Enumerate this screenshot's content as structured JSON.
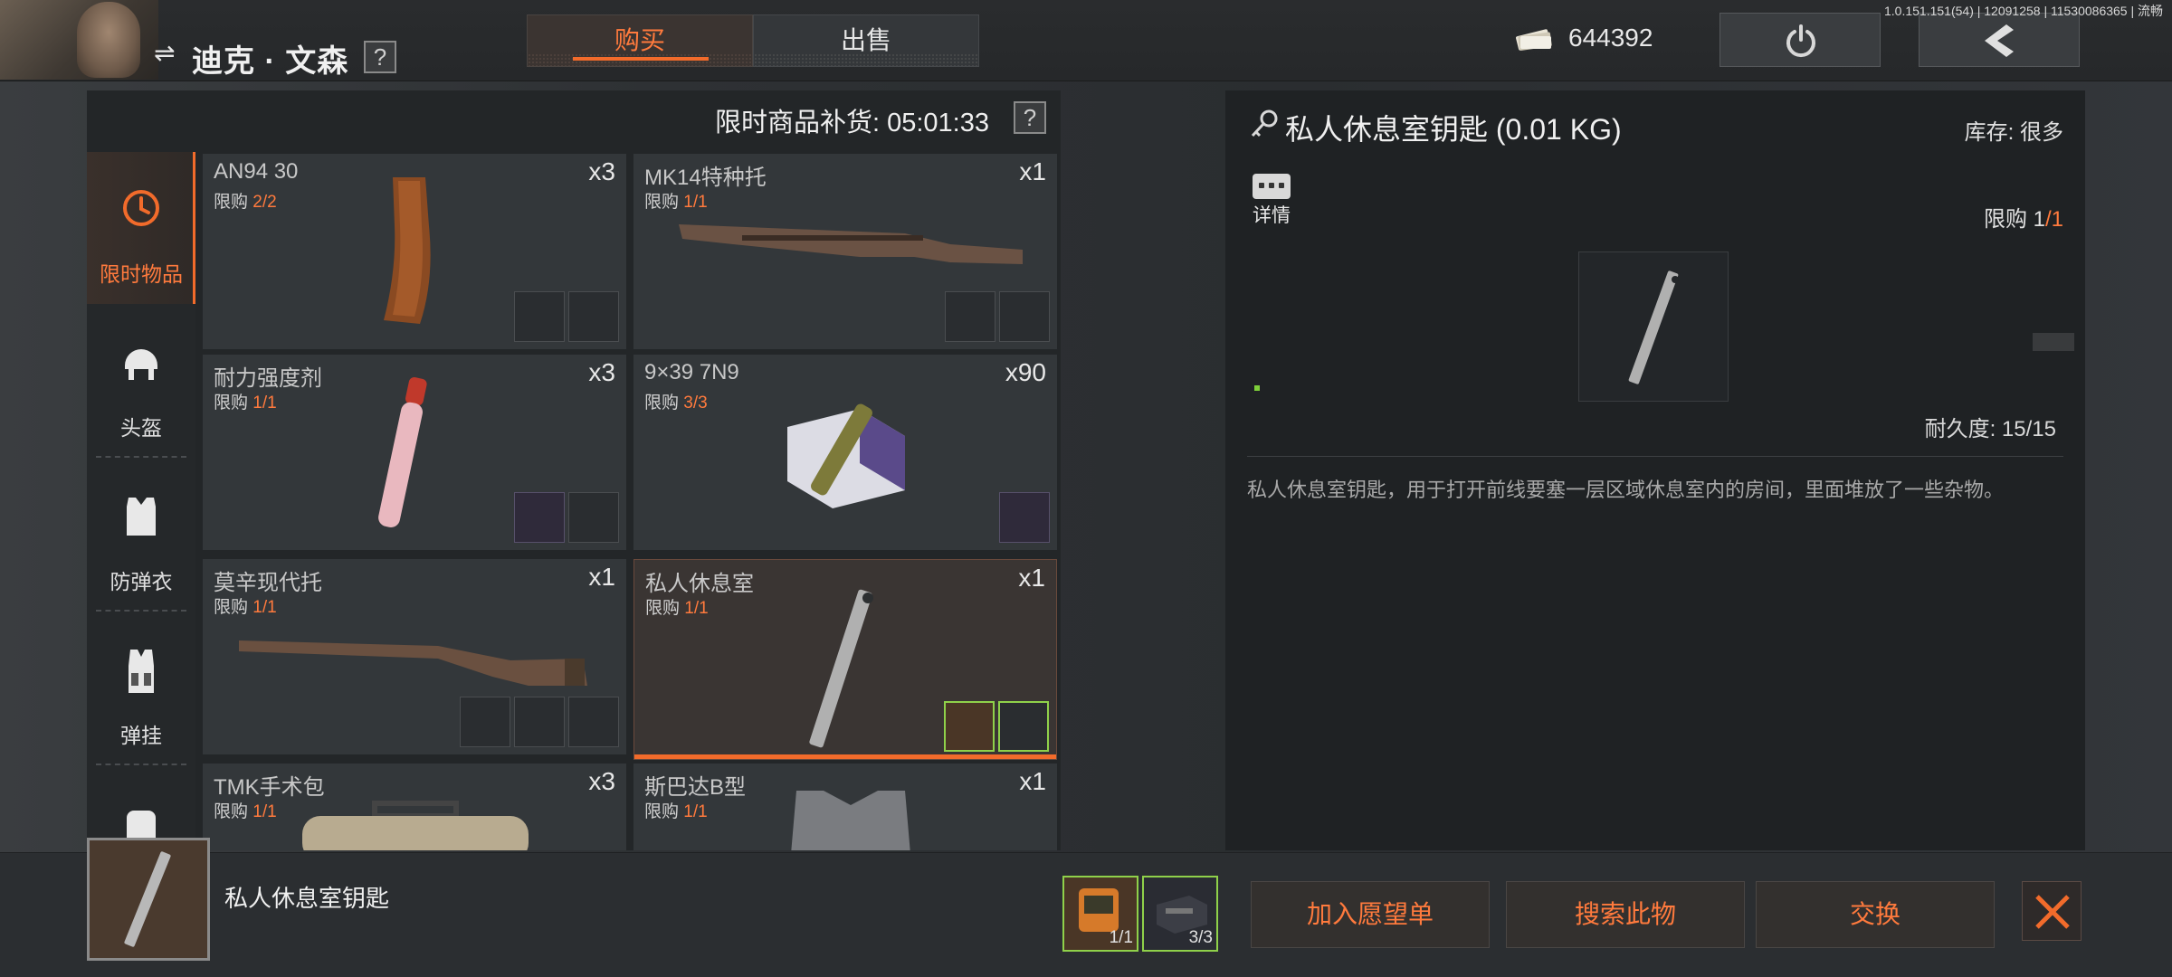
{
  "header": {
    "player_name": "迪克 · 文森",
    "help": "?",
    "tabs": [
      {
        "label": "购买",
        "active": true
      },
      {
        "label": "出售",
        "active": false
      }
    ],
    "cash": "644392",
    "version": "1.0.151.151(54) | 12091258 | 11530086365 | 流畅",
    "icons": [
      "switch-icon",
      "cash-icon",
      "power-icon",
      "back-arrow-icon"
    ]
  },
  "restock": {
    "text": "限时商品补货: 05:01:33",
    "help": "?"
  },
  "sidebar": {
    "items": [
      {
        "label": "限时物品",
        "icon": "clock-icon",
        "active": true
      },
      {
        "label": "头盔",
        "icon": "helmet-icon",
        "active": false
      },
      {
        "label": "防弹衣",
        "icon": "vest-icon",
        "active": false
      },
      {
        "label": "弹挂",
        "icon": "chest-rig-icon",
        "active": false
      }
    ]
  },
  "items": [
    {
      "name": "AN94 30",
      "limit_label": "限购",
      "limit": "2/2",
      "qty": "x3"
    },
    {
      "name": "MK14特种托",
      "limit_label": "限购",
      "limit": "1/1",
      "qty": "x1"
    },
    {
      "name": "耐力强度剂",
      "limit_label": "限购",
      "limit": "1/1",
      "qty": "x3"
    },
    {
      "name": "9×39 7N9",
      "limit_label": "限购",
      "limit": "3/3",
      "qty": "x90"
    },
    {
      "name": "莫辛现代托",
      "limit_label": "限购",
      "limit": "1/1",
      "qty": "x1"
    },
    {
      "name": "私人休息室",
      "limit_label": "限购",
      "limit": "1/1",
      "qty": "x1",
      "selected": true
    },
    {
      "name": "TMK手术包",
      "limit_label": "限购",
      "limit": "1/1",
      "qty": "x3"
    },
    {
      "name": "斯巴达B型",
      "limit_label": "限购",
      "limit": "1/1",
      "qty": "x1"
    }
  ],
  "detail": {
    "title": "私人休息室钥匙 (0.01 KG)",
    "stock": "库存: 很多",
    "info_label": "详情",
    "limit_prefix": "限购 ",
    "limit_a": "1",
    "limit_b": "/1",
    "durability": "耐久度: 15/15",
    "description": "私人休息室钥匙，用于打开前线要塞一层区域休息室内的房间，里面堆放了一些杂物。"
  },
  "bottom": {
    "selected_name": "私人休息室钥匙",
    "requirements": [
      {
        "count": "1/1",
        "icon": "radio-device-icon"
      },
      {
        "count": "3/3",
        "icon": "electronic-box-icon"
      }
    ],
    "actions": {
      "wishlist": "加入愿望单",
      "search": "搜索此物",
      "exchange": "交换"
    }
  },
  "colors": {
    "accent": "#f26b2b",
    "accent_text": "#ff7a3d",
    "requirement_border": "#8fd14a"
  }
}
